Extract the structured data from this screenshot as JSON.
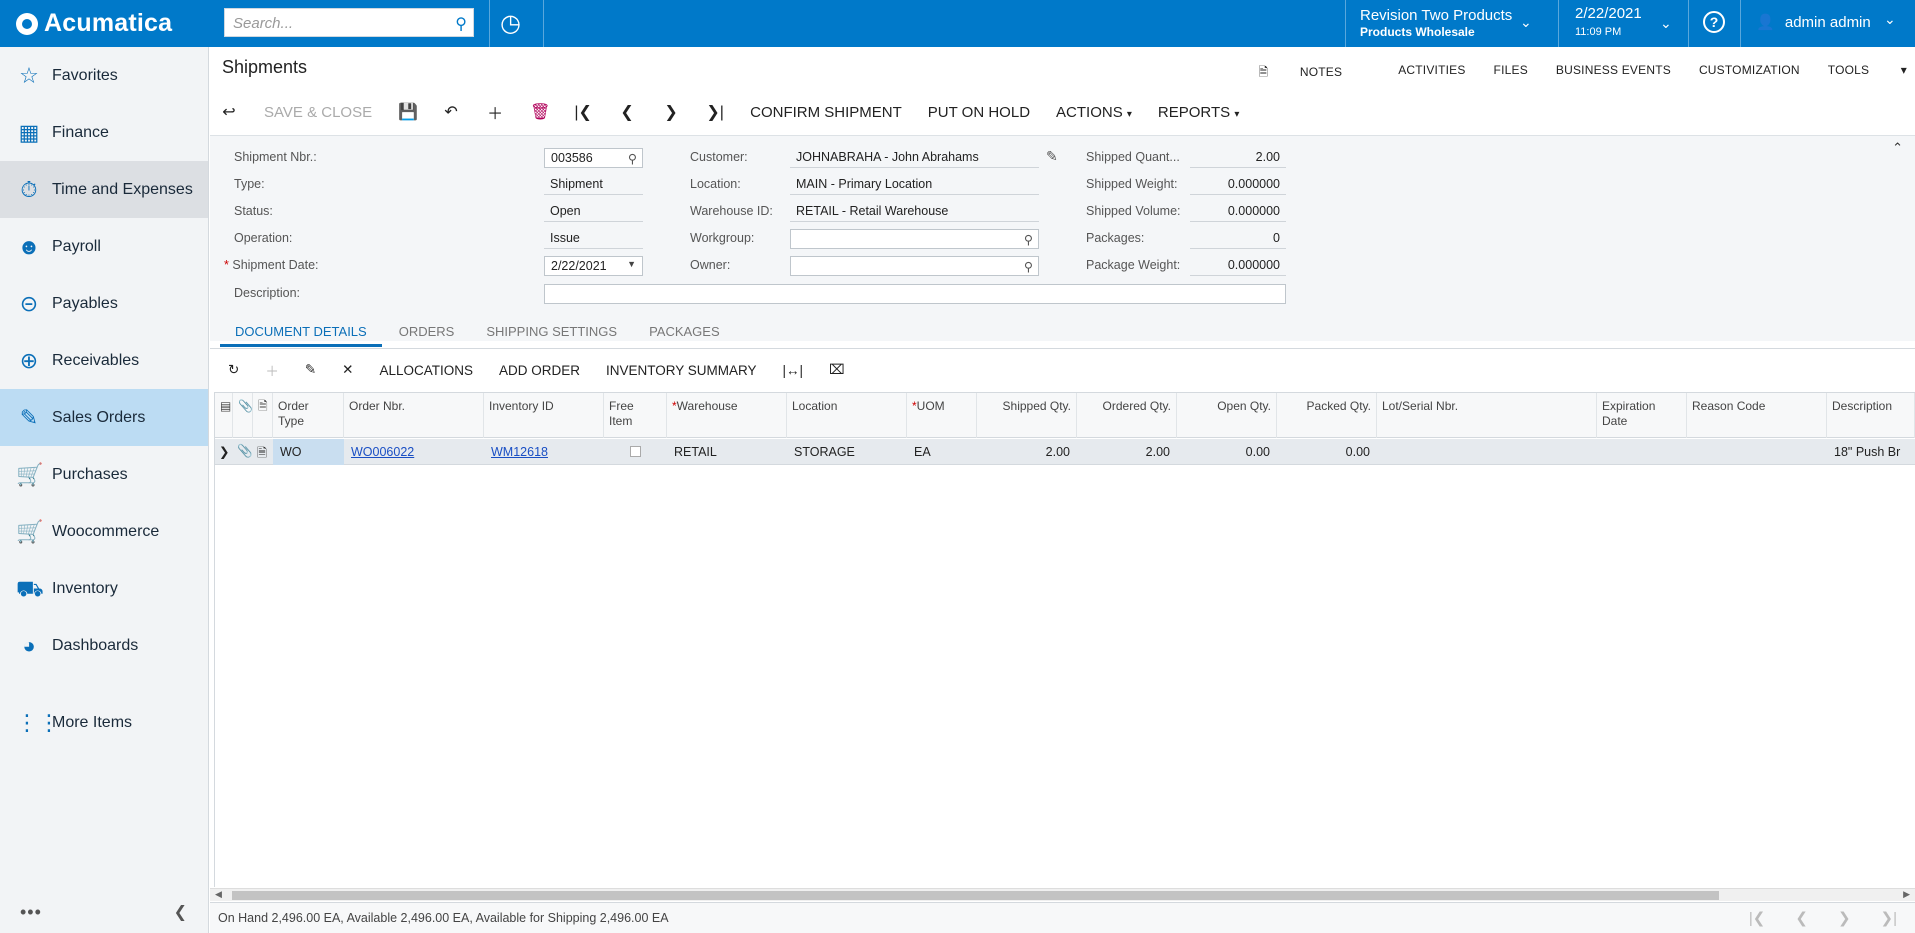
{
  "app": {
    "brand": "Acumatica"
  },
  "topbar": {
    "search_placeholder": "Search...",
    "tenant_name": "Revision Two Products",
    "tenant_branch": "Products Wholesale",
    "date": "2/22/2021",
    "time": "11:09 PM",
    "user": "admin admin",
    "help": "?"
  },
  "sidebar": {
    "items": [
      {
        "label": "Favorites",
        "icon": "star-icon"
      },
      {
        "label": "Finance",
        "icon": "calculator-icon"
      },
      {
        "label": "Time and Expenses",
        "icon": "stopwatch-icon"
      },
      {
        "label": "Payroll",
        "icon": "person-dollar-icon"
      },
      {
        "label": "Payables",
        "icon": "minus-circle-icon"
      },
      {
        "label": "Receivables",
        "icon": "plus-circle-icon"
      },
      {
        "label": "Sales Orders",
        "icon": "edit-icon"
      },
      {
        "label": "Purchases",
        "icon": "cart-icon"
      },
      {
        "label": "Woocommerce",
        "icon": "cart-plus-icon"
      },
      {
        "label": "Inventory",
        "icon": "truck-icon"
      },
      {
        "label": "Dashboards",
        "icon": "gauge-icon"
      },
      {
        "label": "More Items",
        "icon": "grid-dots-icon"
      }
    ]
  },
  "page": {
    "title": "Shipments",
    "top_links": [
      "NOTES",
      "ACTIVITIES",
      "FILES",
      "BUSINESS EVENTS",
      "CUSTOMIZATION",
      "TOOLS"
    ],
    "toolbar": {
      "save_close": "SAVE & CLOSE",
      "confirm_shipment": "CONFIRM SHIPMENT",
      "put_on_hold": "PUT ON HOLD",
      "actions": "ACTIONS",
      "reports": "REPORTS"
    }
  },
  "form": {
    "shipment_nbr_label": "Shipment Nbr.:",
    "shipment_nbr": "003586",
    "type_label": "Type:",
    "type": "Shipment",
    "status_label": "Status:",
    "status": "Open",
    "operation_label": "Operation:",
    "operation": "Issue",
    "shipment_date_label": "Shipment Date:",
    "shipment_date": "2/22/2021",
    "description_label": "Description:",
    "description": "",
    "customer_label": "Customer:",
    "customer": "JOHNABRAHA - John Abrahams",
    "location_label": "Location:",
    "location": "MAIN - Primary Location",
    "warehouse_label": "Warehouse ID:",
    "warehouse": "RETAIL - Retail Warehouse",
    "workgroup_label": "Workgroup:",
    "workgroup": "",
    "owner_label": "Owner:",
    "owner": "",
    "shipped_qty_label": "Shipped Quant...",
    "shipped_qty": "2.00",
    "shipped_weight_label": "Shipped Weight:",
    "shipped_weight": "0.000000",
    "shipped_volume_label": "Shipped Volume:",
    "shipped_volume": "0.000000",
    "packages_label": "Packages:",
    "packages": "0",
    "package_weight_label": "Package Weight:",
    "package_weight": "0.000000"
  },
  "tabs": [
    "DOCUMENT DETAILS",
    "ORDERS",
    "SHIPPING SETTINGS",
    "PACKAGES"
  ],
  "grid_toolbar": {
    "allocations": "ALLOCATIONS",
    "add_order": "ADD ORDER",
    "inventory_summary": "INVENTORY SUMMARY"
  },
  "grid": {
    "headers": {
      "order_type_1": "Order",
      "order_type_2": "Type",
      "order_nbr": "Order Nbr.",
      "inventory_id": "Inventory ID",
      "free_item_1": "Free",
      "free_item_2": "Item",
      "warehouse": "Warehouse",
      "location": "Location",
      "uom": "UOM",
      "shipped_qty": "Shipped Qty.",
      "ordered_qty": "Ordered Qty.",
      "open_qty": "Open Qty.",
      "packed_qty": "Packed Qty.",
      "lot_serial": "Lot/Serial Nbr.",
      "expiration_1": "Expiration",
      "expiration_2": "Date",
      "reason_code": "Reason Code",
      "description": "Description"
    },
    "row": {
      "order_type": "WO",
      "order_nbr": "WO006022",
      "inventory_id": "WM12618",
      "warehouse": "RETAIL",
      "location": "STORAGE",
      "uom": "EA",
      "shipped_qty": "2.00",
      "ordered_qty": "2.00",
      "open_qty": "0.00",
      "packed_qty": "0.00",
      "description": "18\" Push Br"
    }
  },
  "footer": {
    "text": "On Hand 2,496.00 EA, Available 2,496.00 EA, Available for Shipping 2,496.00 EA"
  }
}
